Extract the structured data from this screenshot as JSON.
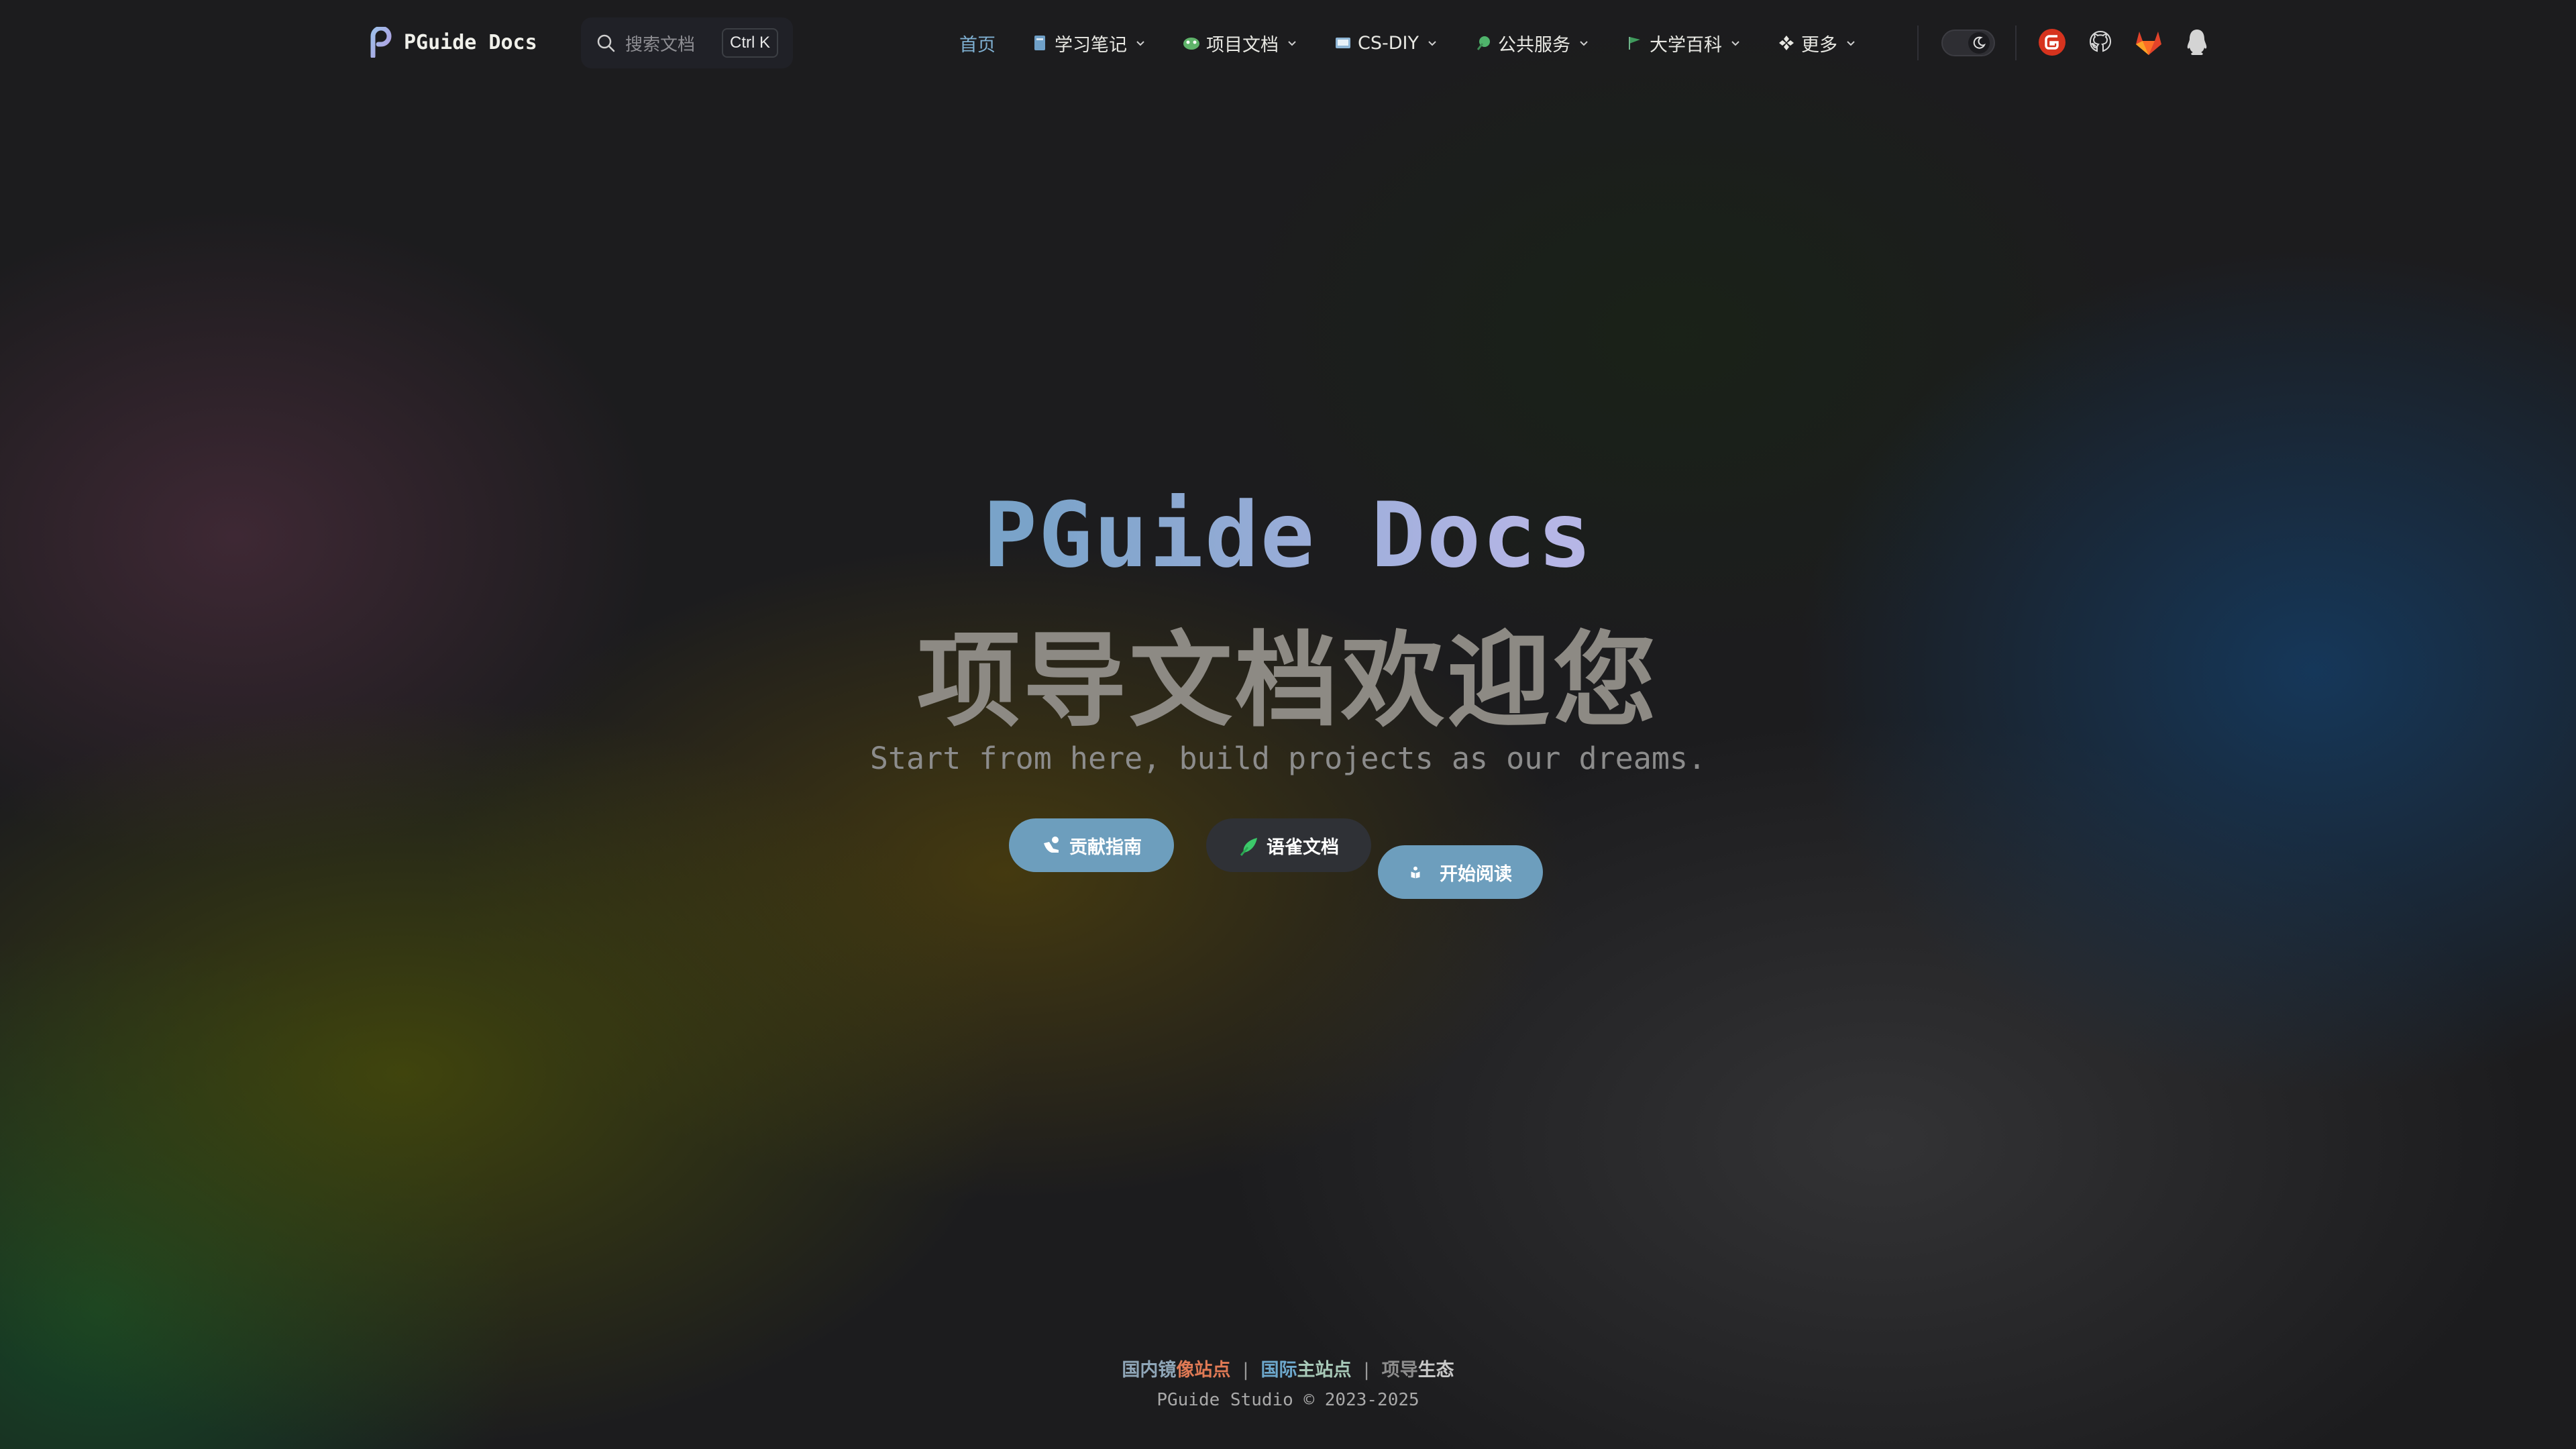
{
  "nav": {
    "brand": "PGuide Docs",
    "search": {
      "placeholder": "搜索文档",
      "shortcut": "Ctrl K"
    },
    "menu": [
      {
        "label": "首页",
        "icon": "none",
        "active": true,
        "dropdown": false
      },
      {
        "label": "学习笔记",
        "icon": "notebook-icon",
        "active": false,
        "dropdown": true
      },
      {
        "label": "项目文档",
        "icon": "dino-icon",
        "active": false,
        "dropdown": true
      },
      {
        "label": "CS-DIY",
        "icon": "computer-icon",
        "active": false,
        "dropdown": true
      },
      {
        "label": "公共服务",
        "icon": "leaf-icon",
        "active": false,
        "dropdown": true
      },
      {
        "label": "大学百科",
        "icon": "flag-icon",
        "active": false,
        "dropdown": true
      },
      {
        "label": "更多",
        "icon": "grid-icon",
        "active": false,
        "dropdown": true
      }
    ],
    "social": [
      "gitee-icon",
      "github-icon",
      "gitlab-icon",
      "qq-icon"
    ]
  },
  "hero": {
    "name": "PGuide Docs",
    "text": "项导文档欢迎您",
    "tagline": "Start from here, build projects as our dreams.",
    "actions": [
      {
        "label": "开始阅读",
        "icon": "reader-icon"
      },
      {
        "label": "贡献指南",
        "icon": "contribute-icon"
      },
      {
        "label": "语雀文档",
        "icon": "yuque-icon"
      }
    ]
  },
  "footer": {
    "links": [
      {
        "parts": [
          {
            "text": "国内镜",
            "color": "#8fa6b8"
          },
          {
            "text": "像站点",
            "color": "#e07a55"
          }
        ]
      },
      {
        "parts": [
          {
            "text": "国际",
            "color": "#6da8cc"
          },
          {
            "text": "主站点",
            "color": "#a8c9b8"
          }
        ]
      },
      {
        "parts": [
          {
            "text": "项导",
            "color": "#8d8d8d"
          },
          {
            "text": "生态",
            "color": "#c9c9c9"
          }
        ]
      }
    ],
    "separator": "|",
    "copyright": "PGuide Studio © 2023-2025"
  },
  "colors": {
    "brand": "#6d9ebd",
    "navActive": "#7fb0d2",
    "background": "#1b1b1f"
  }
}
